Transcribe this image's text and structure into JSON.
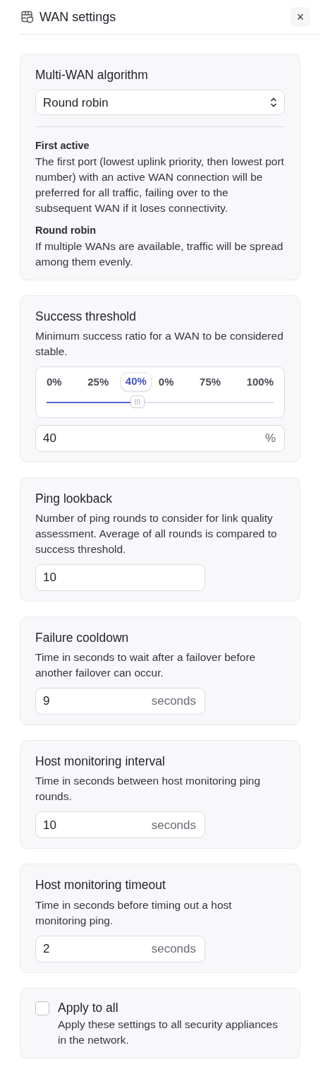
{
  "header": {
    "title": "WAN settings",
    "close": "×"
  },
  "sections": [
    {
      "kind": "select",
      "title": "Multi-WAN algorithm",
      "value": "Round robin",
      "options": [
        {
          "name": "First active",
          "text": "The first port (lowest uplink priority, then lowest port number) with an active WAN connection will be preferred for all traffic, failing over to the subsequent WAN if it loses connectivity."
        },
        {
          "name": "Round robin",
          "text": "If multiple WANs are available, traffic will be spread among them evenly."
        }
      ]
    },
    {
      "kind": "slider",
      "title": "Success threshold",
      "description": "Minimum success ratio for a WAN to be considered stable.",
      "ticks": [
        "0%",
        "25%",
        "0%",
        "75%",
        "100%"
      ],
      "level": 0.4,
      "tooltip": "40%",
      "value": "40",
      "unit": "%"
    },
    {
      "kind": "number",
      "title": "Ping lookback",
      "description": "Number of ping rounds to consider for link quality assessment. Average of all rounds is compared to success threshold.",
      "value": "10"
    },
    {
      "kind": "number",
      "title": "Failure cooldown",
      "description": "Time in seconds to wait after a failover before another failover can occur.",
      "value": "9",
      "unit": "seconds"
    },
    {
      "kind": "number",
      "title": "Host monitoring interval",
      "description": "Time in seconds between host monitoring ping rounds.",
      "value": "10",
      "unit": "seconds"
    },
    {
      "kind": "number",
      "title": "Host monitoring timeout",
      "description": "Time in seconds before timing out a host monitoring ping.",
      "value": "2",
      "unit": "seconds"
    },
    {
      "kind": "checkbox",
      "title": "Apply to all",
      "description": "Apply these settings to all security appliances in the network.",
      "checked": false
    }
  ]
}
